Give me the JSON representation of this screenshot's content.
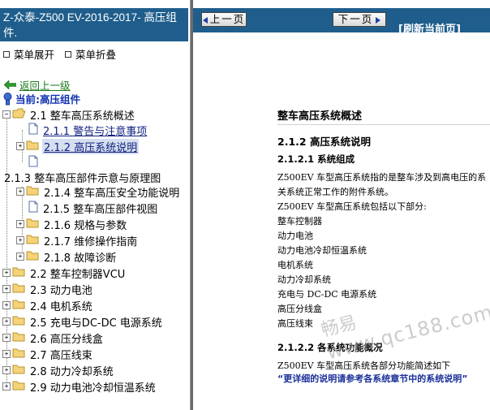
{
  "left": {
    "title": "Z-众泰-Z500 EV-2016-2017- 高压组件.",
    "menu_expand": "菜单展开",
    "menu_collapse": "菜单折叠",
    "back": "返回上一级",
    "current": "当前:高压组件",
    "tree": [
      {
        "label": "2.1 整车高压系统概述"
      },
      {
        "label": "2.1.1 警告与注意事项"
      },
      {
        "label": "2.1.2 高压系统说明"
      },
      {
        "label": "2.1.3 整车高压部件示意与原理图"
      },
      {
        "label": "2.1.4 整车高压安全功能说明"
      },
      {
        "label": "2.1.5 整车高压部件视图"
      },
      {
        "label": "2.1.6 规格与参数"
      },
      {
        "label": "2.1.7 维修操作指南"
      },
      {
        "label": "2.1.8 故障诊断"
      },
      {
        "label": "2.2 整车控制器VCU"
      },
      {
        "label": "2.3 动力电池"
      },
      {
        "label": "2.4 电机系统"
      },
      {
        "label": "2.5 充电与DC-DC 电源系统"
      },
      {
        "label": "2.6 高压分线盒"
      },
      {
        "label": "2.7 高压线束"
      },
      {
        "label": "2.8 动力冷却系统"
      },
      {
        "label": "2.9 动力电池冷却恒温系统"
      }
    ]
  },
  "right": {
    "prev_label": "上一页",
    "next_label": "下一页",
    "refresh_label": "[刷新当前页]",
    "doc": {
      "section_title": "整车高压系统概述",
      "h1": "2.1.2  高压系统说明",
      "h2": "2.1.2.1  系统组成",
      "p1": "Z500EV 车型高压系统指的是整车涉及到高电压的系",
      "p2": "关系统正常工作的附件系统。",
      "p3": "Z500EV 车型高压系统包括以下部分:",
      "items": [
        "整车控制器",
        "动力电池",
        "动力电池冷却恒温系统",
        "电机系统",
        "动力冷却系统",
        "充电与 DC-DC 电源系统",
        "高压分线盒",
        "高压线束"
      ],
      "h3": "2.1.2.2  各系统功能概况",
      "p4": "Z500EV 车型高压系统各部分功能简述如下",
      "note": "“更详细的说明请参考各系统章节中的系统说明”"
    },
    "watermark_text": "畅易",
    "watermark_url": "www.qc188.com"
  }
}
